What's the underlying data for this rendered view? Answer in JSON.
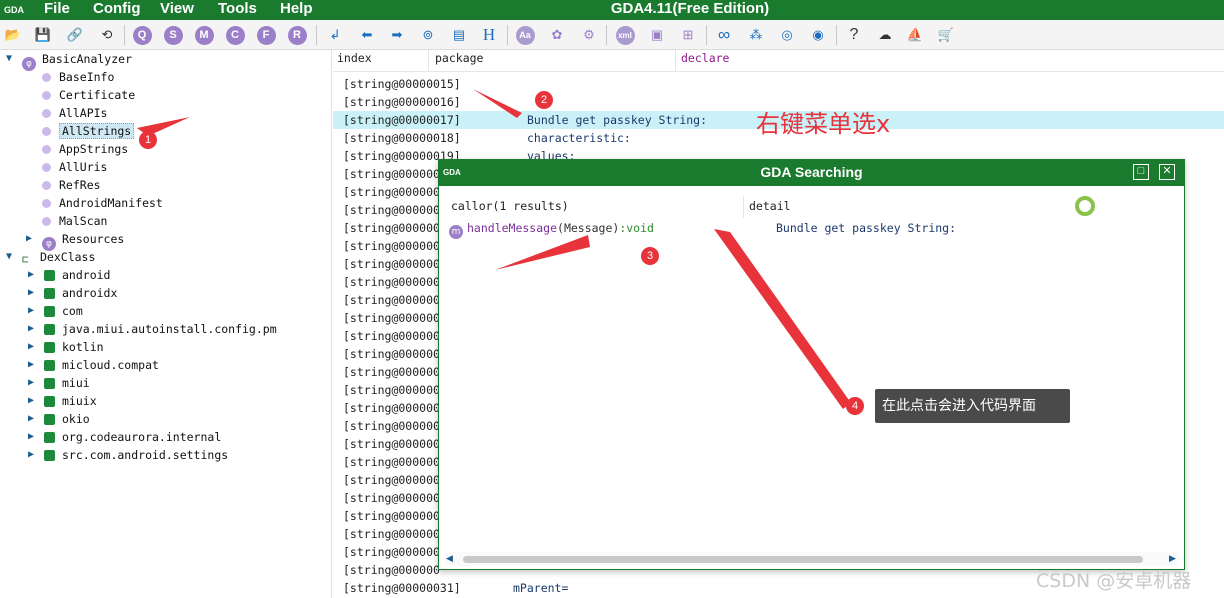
{
  "titlebar": {
    "logo": "GDA",
    "menu": [
      "File",
      "Config",
      "View",
      "Tools",
      "Help"
    ],
    "title": "GDA4.11(Free Edition)"
  },
  "toolbar": {
    "circle_letters": [
      "Q",
      "S",
      "M",
      "C",
      "F",
      "R"
    ],
    "text_buttons": [
      "H",
      "Aa",
      "xml",
      "?"
    ]
  },
  "tree": {
    "root": "BasicAnalyzer",
    "basic_items": [
      "BaseInfo",
      "Certificate",
      "AllAPIs",
      "AllStrings",
      "AppStrings",
      "AllUris",
      "RefRes",
      "AndroidManifest",
      "MalScan"
    ],
    "resources": "Resources",
    "dexclass": "DexClass",
    "packages": [
      "android",
      "androidx",
      "com",
      "java.miui.autoinstall.config.pm",
      "kotlin",
      "micloud.compat",
      "miui",
      "miuix",
      "okio",
      "org.codeaurora.internal",
      "src.com.android.settings"
    ],
    "selected": "AllStrings"
  },
  "main": {
    "columns": [
      "index",
      "package",
      "declare"
    ],
    "rows": [
      {
        "index": "[string@00000015]",
        "code": ""
      },
      {
        "index": "[string@00000016]",
        "code": ""
      },
      {
        "index": "[string@00000017]",
        "code": "Bundle get passkey String:"
      },
      {
        "index": "[string@00000018]",
        "code": "characteristic:"
      },
      {
        "index": "[string@00000019]",
        "code": "values:"
      }
    ],
    "truncated_index": "[string@000000",
    "last_row": {
      "index": "[string@00000031]",
      "code": "mParent="
    }
  },
  "dialog": {
    "logo": "GDA",
    "title": "GDA Searching",
    "col_callor": "callor(1 results)",
    "col_detail": "detail",
    "result": {
      "badge": "m",
      "name": "handleMessage",
      "param": "(Message)",
      "ret": ":void",
      "detail": "Bundle get passkey String:"
    }
  },
  "annotations": {
    "badges": [
      "1",
      "2",
      "3",
      "4"
    ],
    "callout": "右键菜单选x",
    "tooltip": "在此点击会进入代码界面",
    "watermark": "CSDN @安卓机器",
    "color": "#e8333b"
  }
}
